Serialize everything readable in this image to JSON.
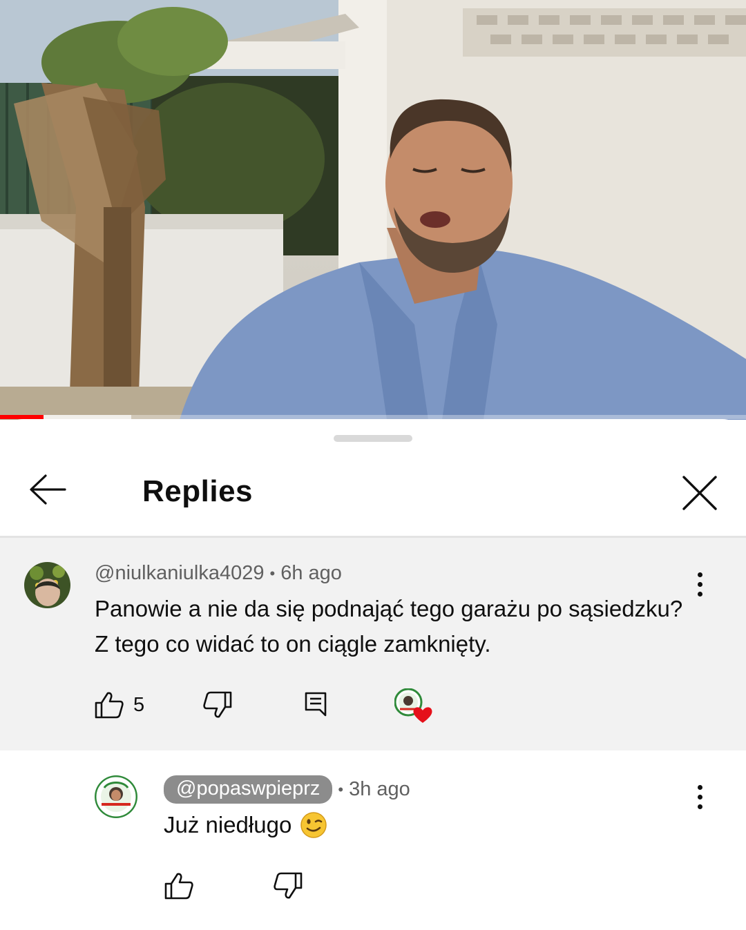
{
  "video": {
    "progress": {
      "played_fraction": 0.058,
      "buffered_fraction": 0.176
    }
  },
  "sheet": {
    "title": "Replies",
    "icons": {
      "back": "arrow-left-icon",
      "close": "close-x-icon"
    }
  },
  "parent_comment": {
    "author": "@niulkaniulka4029",
    "separator": "•",
    "time": "6h ago",
    "text": "Panowie a nie da się podnająć tego garażu po sąsiedzku? Z tego co widać to on ciągle zamknięty.",
    "like_count": "5",
    "icons": {
      "like": "thumbs-up-icon",
      "dislike": "thumbs-down-icon",
      "reply": "comment-icon",
      "creator_heart": "creator-heart-icon",
      "more": "more-vertical-icon"
    }
  },
  "reply_comment": {
    "author": "@popaswpieprz",
    "separator": "•",
    "time": "3h ago",
    "text": "Już niedługo",
    "emoji": "winking-face-emoji",
    "icons": {
      "like": "thumbs-up-icon",
      "dislike": "thumbs-down-icon",
      "more": "more-vertical-icon"
    }
  },
  "colors": {
    "progress_red": "#ff0000",
    "author_chip": "#8c8c8c",
    "parent_bg": "#f2f2f2",
    "heart": "#e5101a"
  }
}
